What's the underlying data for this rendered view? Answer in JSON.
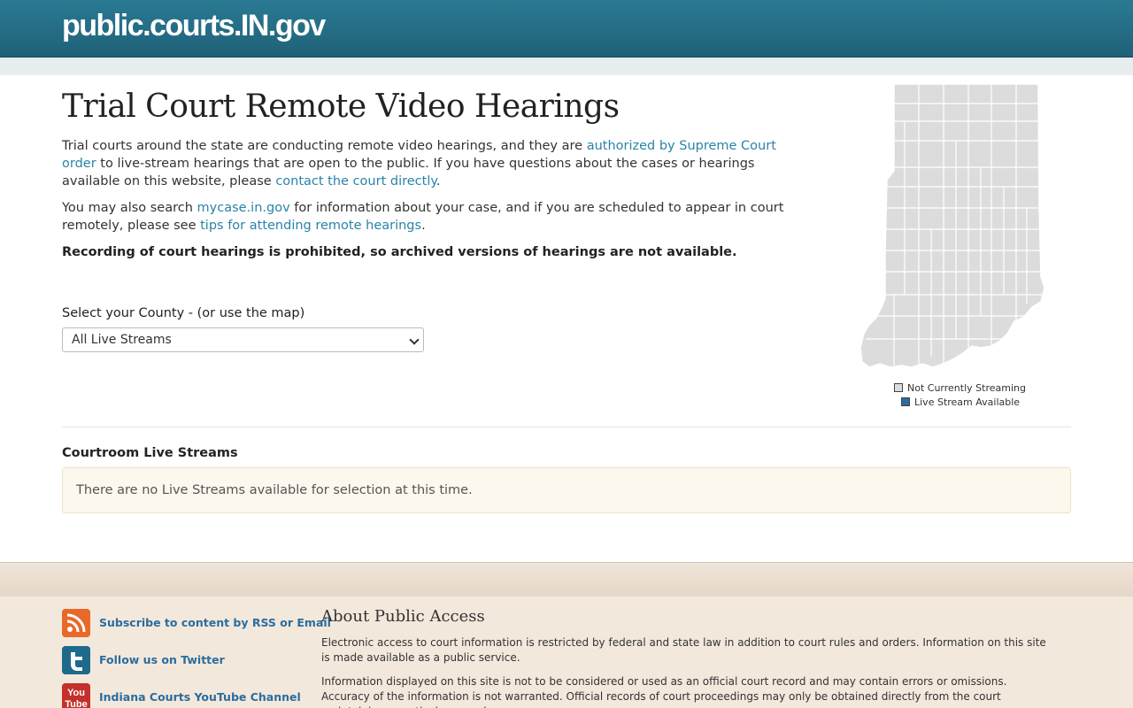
{
  "header": {
    "site_title": "public.courts.IN.gov"
  },
  "main": {
    "title": "Trial Court Remote Video Hearings",
    "p1": {
      "text1": "Trial courts around the state are conducting remote video hearings, and they are ",
      "link1": "authorized by Supreme Court order",
      "text2": " to live-stream hearings that are open to the public. If you have questions about the cases or hearings available on this website, please ",
      "link2": "contact the court directly",
      "text3": "."
    },
    "p2": {
      "text1": "You may also search ",
      "link1": "mycase.in.gov",
      "text2": " for information about your case, and if you are scheduled to appear in court remotely, please see ",
      "link2": "tips for attending remote hearings",
      "text3": "."
    },
    "p3": "Recording of court hearings is prohibited, so archived versions of hearings are not available.",
    "county_label": "Select your County - (or use the map)",
    "county_select": "All Live Streams"
  },
  "map": {
    "legend_not_streaming": "Not Currently Streaming",
    "legend_live": "Live Stream Available",
    "color_not_streaming": "#dcdcdc",
    "color_live": "#2a6d9e"
  },
  "streams": {
    "title": "Courtroom Live Streams",
    "notice": "There are no Live Streams available for selection at this time."
  },
  "footer": {
    "rss": "Subscribe to content by RSS or Email",
    "twitter": "Follow us on Twitter",
    "youtube": "Indiana Courts YouTube Channel",
    "youtube_icon_text": "You Tube",
    "about_title": "About Public Access",
    "about_p1": "Electronic access to court information is restricted by federal and state law in addition to court rules and orders. Information on this site is made available as a public service.",
    "about_p2": "Information displayed on this site is not to be considered or used as an official court record and may contain errors or omissions. Accuracy of the information is not warranted. Official records of court proceedings may only be obtained directly from the court maintaining a particular record."
  }
}
